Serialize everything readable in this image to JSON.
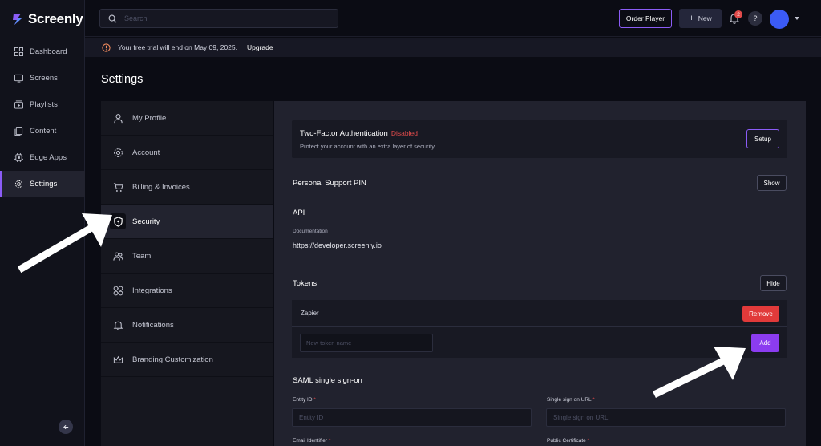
{
  "app": {
    "name": "Screenly"
  },
  "nav": {
    "items": [
      {
        "label": "Dashboard",
        "icon": "dashboard-icon"
      },
      {
        "label": "Screens",
        "icon": "screen-icon"
      },
      {
        "label": "Playlists",
        "icon": "playlist-icon"
      },
      {
        "label": "Content",
        "icon": "content-icon"
      },
      {
        "label": "Edge Apps",
        "icon": "edge-apps-icon"
      },
      {
        "label": "Settings",
        "icon": "gear-icon",
        "active": true
      }
    ]
  },
  "topbar": {
    "search_placeholder": "Search",
    "order_player_label": "Order Player",
    "new_label": "New",
    "notification_count": "2",
    "help_label": "?"
  },
  "banner": {
    "text": "Your free trial will end on May 09, 2025.",
    "upgrade_label": "Upgrade"
  },
  "page": {
    "title": "Settings"
  },
  "submenu": {
    "items": [
      {
        "label": "My Profile",
        "icon": "user-icon"
      },
      {
        "label": "Account",
        "icon": "account-gear-icon"
      },
      {
        "label": "Billing & Invoices",
        "icon": "cart-icon"
      },
      {
        "label": "Security",
        "icon": "shield-icon",
        "active": true
      },
      {
        "label": "Team",
        "icon": "team-icon"
      },
      {
        "label": "Integrations",
        "icon": "integrations-icon"
      },
      {
        "label": "Notifications",
        "icon": "notification-icon"
      },
      {
        "label": "Branding Customization",
        "icon": "crown-icon"
      }
    ]
  },
  "security": {
    "tfa": {
      "title": "Two-Factor Authentication",
      "status": "Disabled",
      "description": "Protect your account with an extra layer of security.",
      "setup_label": "Setup"
    },
    "support_pin": {
      "title": "Personal Support PIN",
      "show_label": "Show"
    },
    "api": {
      "title": "API",
      "documentation_label": "Documentation",
      "documentation_url": "https://developer.screenly.io"
    },
    "tokens": {
      "title": "Tokens",
      "hide_label": "Hide",
      "items": [
        {
          "name": "Zapier",
          "remove_label": "Remove"
        }
      ],
      "new_token_placeholder": "New token name",
      "add_label": "Add"
    },
    "saml": {
      "title": "SAML single sign-on",
      "entity_id_label": "Entity ID",
      "entity_id_placeholder": "Entity ID",
      "sso_url_label": "Single sign on URL",
      "sso_url_placeholder": "Single sign on URL",
      "email_identifier_label": "Email Identifier",
      "public_certificate_label": "Public Certificate",
      "required_marker": "*"
    }
  },
  "colors": {
    "accent": "#8b5cf6",
    "danger": "#e13a3a",
    "avatar": "#3b5bf6",
    "add_button": "#8b3cf0"
  }
}
